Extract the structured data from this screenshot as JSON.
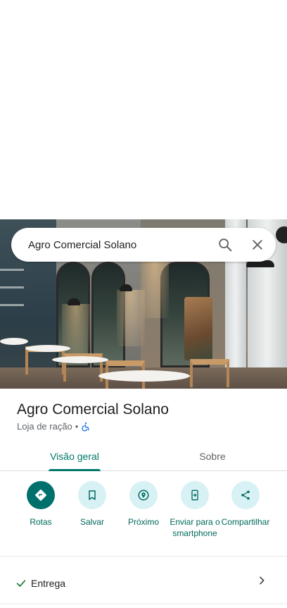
{
  "search": {
    "value": "Agro Comercial Solano"
  },
  "place": {
    "name": "Agro Comercial Solano",
    "category": "Loja de ração",
    "separator": "•"
  },
  "tabs": [
    {
      "label": "Visão geral",
      "active": true
    },
    {
      "label": "Sobre",
      "active": false
    }
  ],
  "actions": [
    {
      "label": "Rotas",
      "icon": "directions-icon"
    },
    {
      "label": "Salvar",
      "icon": "bookmark-icon"
    },
    {
      "label": "Próximo",
      "icon": "nearby-icon"
    },
    {
      "label": "Enviar para o smartphone",
      "icon": "send-to-phone-icon"
    },
    {
      "label": "Compartilhar",
      "icon": "share-icon"
    }
  ],
  "attributes": [
    {
      "label": "Entrega",
      "icon": "check-icon"
    }
  ],
  "colors": {
    "accent": "#00796b",
    "action_bg": "#d7f1f5",
    "primary_action_bg": "#00706d",
    "accessibility_blue": "#1a73e8"
  }
}
